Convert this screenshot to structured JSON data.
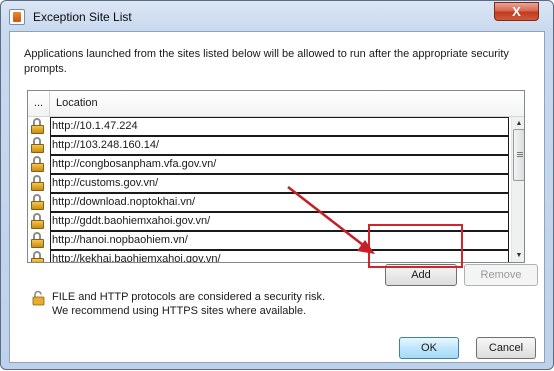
{
  "window": {
    "title": "Exception Site List",
    "close_glyph": "X"
  },
  "description": "Applications launched from the sites listed below will be allowed to run after the appropriate security prompts.",
  "table": {
    "columns": [
      "...",
      "Location"
    ],
    "rows": [
      "http://10.1.47.224",
      "http://103.248.160.14/",
      "http://congbosanpham.vfa.gov.vn/",
      "http://customs.gov.vn/",
      "http://download.noptokhai.vn/",
      "http://gddt.baohiemxahoi.gov.vn/",
      "http://hanoi.nopbaohiem.vn/",
      "http://kekhai.baohiemxahoi.gov.vn/"
    ],
    "row_icon": "unlocked-padlock-icon"
  },
  "buttons": {
    "add": "Add",
    "remove": "Remove",
    "ok": "OK",
    "cancel": "Cancel"
  },
  "warning": {
    "line1": "FILE and HTTP protocols are considered a security risk.",
    "line2": "We recommend using HTTPS sites where available.",
    "icon": "padlock-warning-icon"
  },
  "annotation": {
    "color": "#d1252b"
  }
}
